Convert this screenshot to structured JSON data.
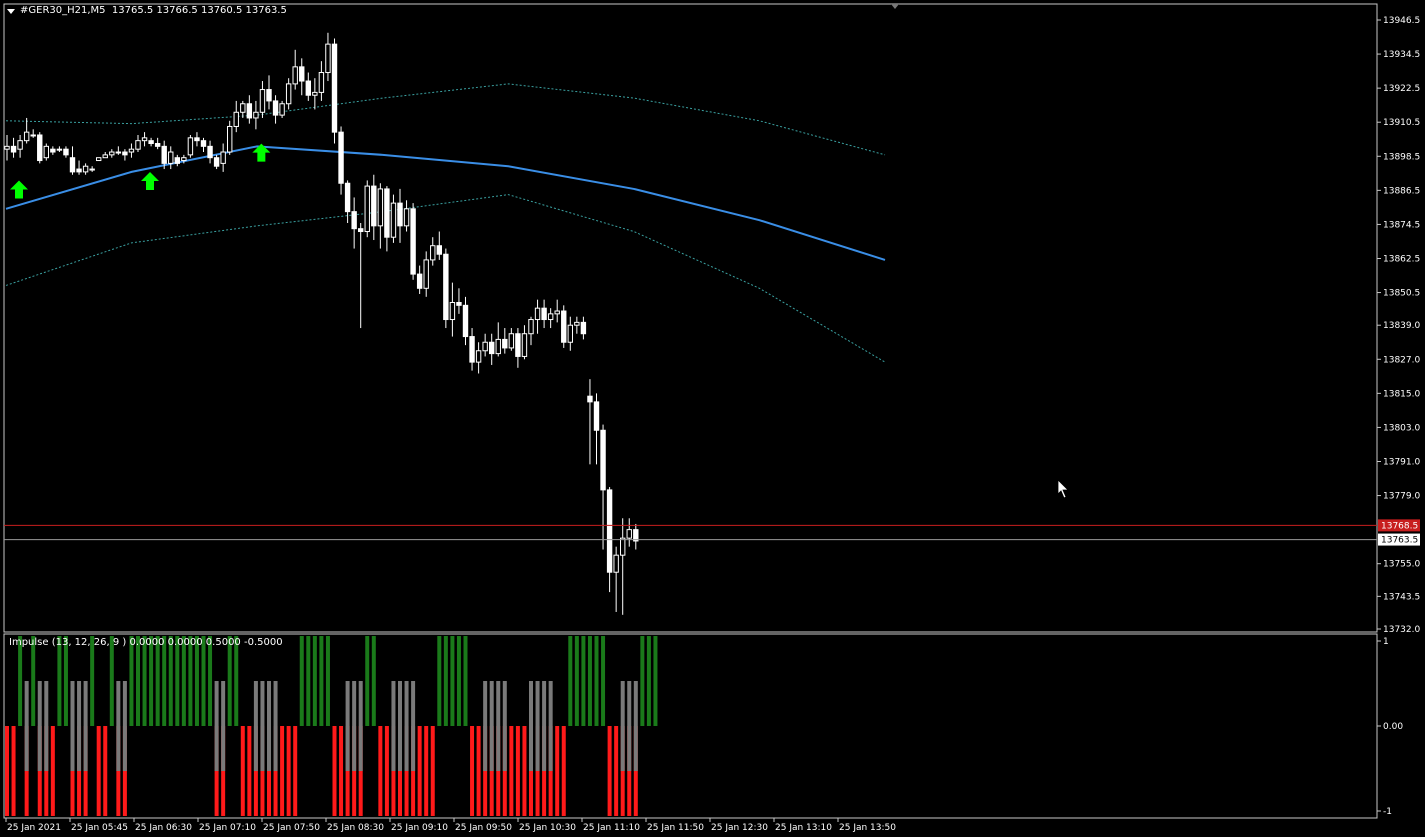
{
  "header": {
    "symbol": "#GER30_H21,M5",
    "ohlc": "13765.5 13766.5 13760.5 13763.5"
  },
  "indicator": {
    "label": "Impulse (13, 12, 26, 9 ) 0.0000 0.0000 0.5000 -0.5000",
    "scale": [
      "1",
      "0.00",
      "-1"
    ]
  },
  "price_axis": {
    "ticks": [
      "13946.5",
      "13934.5",
      "13922.5",
      "13910.5",
      "13898.5",
      "13886.5",
      "13874.5",
      "13862.5",
      "13850.5",
      "13839.0",
      "13827.0",
      "13815.0",
      "13803.0",
      "13791.0",
      "13779.0",
      "13755.0",
      "13743.5",
      "13732.0"
    ],
    "red_line_label": "13768.5",
    "bid_label": "13763.5"
  },
  "time_axis": {
    "labels": [
      "25 Jan 2021",
      "25 Jan 05:45",
      "25 Jan 06:30",
      "25 Jan 07:10",
      "25 Jan 07:50",
      "25 Jan 08:30",
      "25 Jan 09:10",
      "25 Jan 09:50",
      "25 Jan 10:30",
      "25 Jan 11:10",
      "25 Jan 11:50",
      "25 Jan 12:30",
      "25 Jan 13:10",
      "25 Jan 13:50"
    ]
  },
  "colors": {
    "background": "#000000",
    "candle": "#ffffff",
    "ma_line": "#3a8ee6",
    "band_line": "#3aa0a0",
    "red_line": "#c81e1e",
    "arrow": "#00ff00",
    "impulse_green": "#1a7a1a",
    "impulse_gray": "#7a7a7a",
    "impulse_red": "#ff1a1a"
  },
  "chart_data": {
    "type": "candlestick",
    "symbol": "#GER30_H21",
    "timeframe": "M5",
    "ylim": [
      13732.0,
      13946.5
    ],
    "ohlc": [
      [
        13901,
        13906,
        13897,
        13902
      ],
      [
        13902,
        13905,
        13898,
        13900
      ],
      [
        13901,
        13906,
        13898,
        13904
      ],
      [
        13904,
        13912,
        13903,
        13907
      ],
      [
        13906,
        13908,
        13905,
        13906
      ],
      [
        13906,
        13907,
        13896,
        13897
      ],
      [
        13898,
        13903,
        13897,
        13902
      ],
      [
        13901,
        13902,
        13899,
        13900
      ],
      [
        13901,
        13902,
        13900,
        13901
      ],
      [
        13901,
        13902,
        13898,
        13899
      ],
      [
        13898,
        13902,
        13892,
        13893
      ],
      [
        13894,
        13897,
        13892,
        13893
      ],
      [
        13893,
        13896,
        13892,
        13895
      ],
      [
        13894,
        13895,
        13893,
        13894
      ],
      [
        13897,
        13898,
        13897,
        13898
      ],
      [
        13898,
        13900,
        13898,
        13899
      ],
      [
        13899,
        13901,
        13898,
        13900
      ],
      [
        13900,
        13902,
        13899,
        13900
      ],
      [
        13900,
        13901,
        13897,
        13899
      ],
      [
        13900,
        13903,
        13898,
        13901
      ],
      [
        13901,
        13906,
        13900,
        13904
      ],
      [
        13904,
        13907,
        13902,
        13905
      ],
      [
        13904,
        13905,
        13902,
        13903
      ],
      [
        13903,
        13905,
        13901,
        13902
      ],
      [
        13902,
        13904,
        13894,
        13896
      ],
      [
        13896,
        13902,
        13894,
        13900
      ],
      [
        13898,
        13899,
        13895,
        13896
      ],
      [
        13897,
        13899,
        13896,
        13898
      ],
      [
        13899,
        13906,
        13898,
        13905
      ],
      [
        13905,
        13907,
        13902,
        13904
      ],
      [
        13904,
        13905,
        13900,
        13902
      ],
      [
        13902,
        13904,
        13896,
        13898
      ],
      [
        13898,
        13899,
        13894,
        13895
      ],
      [
        13896,
        13903,
        13893,
        13900
      ],
      [
        13900,
        13911,
        13899,
        13909
      ],
      [
        13909,
        13918,
        13907,
        13914
      ],
      [
        13914,
        13918,
        13912,
        13917
      ],
      [
        13917,
        13920,
        13910,
        13912
      ],
      [
        13912,
        13918,
        13908,
        13914
      ],
      [
        13914,
        13925,
        13912,
        13922
      ],
      [
        13922,
        13927,
        13915,
        13918
      ],
      [
        13918,
        13920,
        13910,
        13913
      ],
      [
        13913,
        13918,
        13912,
        13917
      ],
      [
        13917,
        13926,
        13915,
        13924
      ],
      [
        13924,
        13936,
        13922,
        13930
      ],
      [
        13930,
        13933,
        13920,
        13925
      ],
      [
        13925,
        13928,
        13918,
        13920
      ],
      [
        13920,
        13926,
        13915,
        13921
      ],
      [
        13921,
        13932,
        13918,
        13928
      ],
      [
        13928,
        13942,
        13925,
        13938
      ],
      [
        13938,
        13940,
        13903,
        13907
      ],
      [
        13907,
        13909,
        13885,
        13889
      ],
      [
        13889,
        13890,
        13875,
        13879
      ],
      [
        13879,
        13884,
        13866,
        13873
      ],
      [
        13873,
        13875,
        13838,
        13872
      ],
      [
        13872,
        13890,
        13870,
        13888
      ],
      [
        13888,
        13892,
        13869,
        13874
      ],
      [
        13874,
        13889,
        13866,
        13887
      ],
      [
        13887,
        13888,
        13865,
        13870
      ],
      [
        13870,
        13885,
        13868,
        13882
      ],
      [
        13882,
        13887,
        13868,
        13874
      ],
      [
        13874,
        13883,
        13872,
        13880
      ],
      [
        13880,
        13882,
        13855,
        13857
      ],
      [
        13857,
        13860,
        13850,
        13852
      ],
      [
        13852,
        13865,
        13849,
        13862
      ],
      [
        13862,
        13870,
        13860,
        13867
      ],
      [
        13867,
        13872,
        13862,
        13864
      ],
      [
        13864,
        13866,
        13838,
        13841
      ],
      [
        13841,
        13854,
        13835,
        13847
      ],
      [
        13847,
        13852,
        13843,
        13846
      ],
      [
        13846,
        13849,
        13832,
        13835
      ],
      [
        13835,
        13838,
        13823,
        13826
      ],
      [
        13826,
        13833,
        13822,
        13830
      ],
      [
        13830,
        13836,
        13828,
        13833
      ],
      [
        13833,
        13836,
        13825,
        13829
      ],
      [
        13829,
        13840,
        13828,
        13834
      ],
      [
        13834,
        13838,
        13829,
        13831
      ],
      [
        13831,
        13838,
        13830,
        13836
      ],
      [
        13836,
        13838,
        13824,
        13828
      ],
      [
        13828,
        13839,
        13827,
        13836
      ],
      [
        13836,
        13842,
        13832,
        13841
      ],
      [
        13841,
        13848,
        13836,
        13845
      ],
      [
        13845,
        13848,
        13838,
        13841
      ],
      [
        13841,
        13845,
        13838,
        13843
      ],
      [
        13843,
        13848,
        13840,
        13844
      ],
      [
        13844,
        13846,
        13831,
        13833
      ],
      [
        13833,
        13842,
        13830,
        13839
      ],
      [
        13839,
        13842,
        13836,
        13840
      ],
      [
        13840,
        13842,
        13834,
        13836
      ],
      [
        13814,
        13820,
        13790,
        13812
      ],
      [
        13812,
        13815,
        13790,
        13802
      ],
      [
        13802,
        13804,
        13760,
        13781
      ],
      [
        13781,
        13782,
        13745,
        13752
      ],
      [
        13752,
        13761,
        13738,
        13758
      ],
      [
        13758,
        13771,
        13737,
        13764
      ],
      [
        13764,
        13771,
        13761,
        13767
      ],
      [
        13767,
        13769,
        13760,
        13763
      ]
    ],
    "moving_average": [
      13880,
      13893,
      13902,
      13899,
      13895,
      13887,
      13876,
      13862
    ],
    "upper_band": [
      13911,
      13910,
      13913,
      13919,
      13924,
      13919,
      13911,
      13899
    ],
    "lower_band": [
      13853,
      13868,
      13874,
      13879,
      13885,
      13872,
      13852,
      13826
    ],
    "signal_arrows": [
      0,
      20,
      37
    ],
    "impulse": {
      "values_color": "green=1, gray=0/±0.5, red=-1",
      "sequence": [
        "r",
        "r",
        "g",
        "r",
        "g",
        "r",
        "r",
        "r",
        "g",
        "g",
        "r",
        "r",
        "r",
        "g",
        "r",
        "r",
        "g",
        "r",
        "r",
        "g",
        "g",
        "g",
        "g",
        "g",
        "g",
        "g",
        "g",
        "g",
        "g",
        "g",
        "g",
        "g",
        "r",
        "r",
        "g",
        "g",
        "r",
        "r",
        "r",
        "r",
        "r",
        "r",
        "r",
        "r",
        "r",
        "g",
        "g",
        "g",
        "g",
        "g",
        "r",
        "r",
        "r",
        "r",
        "r",
        "g",
        "g",
        "r",
        "r",
        "r",
        "r",
        "r",
        "r",
        "r",
        "r",
        "r",
        "g",
        "g",
        "g",
        "g",
        "g",
        "r",
        "r",
        "r",
        "r",
        "r",
        "r",
        "r",
        "r",
        "r",
        "r",
        "r",
        "r",
        "r",
        "r",
        "r",
        "g",
        "g",
        "g",
        "g",
        "g",
        "g",
        "r",
        "r",
        "r",
        "r",
        "r",
        "g",
        "g",
        "g"
      ]
    }
  }
}
